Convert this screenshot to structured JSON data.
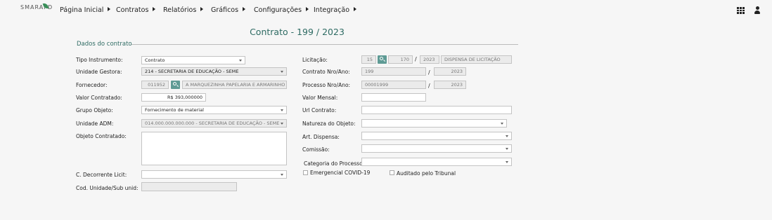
{
  "brand": {
    "logo_text": "SMARAPD"
  },
  "nav": {
    "items": [
      {
        "label": "Página Inicial"
      },
      {
        "label": "Contratos"
      },
      {
        "label": "Relatórios"
      },
      {
        "label": "Gráficos"
      },
      {
        "label": "Configurações"
      },
      {
        "label": "Integração"
      }
    ]
  },
  "page": {
    "title": "Contrato - 199 / 2023",
    "section": "Dados do contrato"
  },
  "form": {
    "tipo_instrumento": {
      "label": "Tipo Instrumento:",
      "value": "Contrato"
    },
    "unidade_gestora": {
      "label": "Unidade Gestora:",
      "value": "214 - SECRETARIA DE EDUCAÇÃO - SEME"
    },
    "fornecedor": {
      "label": "Fornecedor:",
      "code": "011952",
      "name": "A MARQUEZINHA PAPELARIA E ARMARINHO LT"
    },
    "valor_contratado": {
      "label": "Valor Contratado:",
      "value": "R$ 393,000000"
    },
    "grupo_objeto": {
      "label": "Grupo Objeto:",
      "value": "Fornecimento de material"
    },
    "unidade_adm": {
      "label": "Unidade ADM:",
      "value": "014.000.000.000.000 - SECRETARIA  DE EDUCAÇÃO - SEME"
    },
    "objeto_contratado": {
      "label": "Objeto Contratado:",
      "value": ""
    },
    "c_decorrente_licit": {
      "label": "C. Decorrente Licit:",
      "value": ""
    },
    "cod_unidade": {
      "label": "Cod. Unidade/Sub unid:",
      "value": ""
    },
    "licitacao": {
      "label": "Licitação:",
      "num1": "15",
      "num2": "170",
      "year": "2023",
      "modalidade": "DISPENSA DE LICITAÇÃO",
      "sep": "/"
    },
    "contrato_nro_ano": {
      "label": "Contrato Nro/Ano:",
      "nro": "199",
      "ano": "2023",
      "sep": "/"
    },
    "processo_nro_ano": {
      "label": "Processo Nro/Ano:",
      "nro": "00001999",
      "ano": "2023",
      "sep": "/"
    },
    "valor_mensal": {
      "label": "Valor Mensal:",
      "value": ""
    },
    "url_contrato": {
      "label": "Url Contrato:",
      "value": ""
    },
    "natureza_objeto": {
      "label": "Natureza do Objeto:",
      "value": ""
    },
    "art_dispensa": {
      "label": "Art. Dispensa:",
      "value": ""
    },
    "comissao": {
      "label": "Comissão:",
      "value": ""
    },
    "categoria_processo": {
      "label": "Categoria do Processo:",
      "value": ""
    },
    "emergencial_covid": {
      "label": "Emergencial COVID-19",
      "checked": false
    },
    "auditado_tribunal": {
      "label": "Auditado pelo Tribunal",
      "checked": false
    }
  }
}
